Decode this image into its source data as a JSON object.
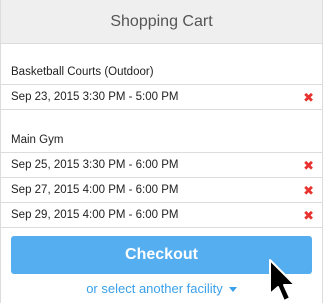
{
  "header": {
    "title": "Shopping Cart"
  },
  "groups": [
    {
      "facility": "Basketball Courts (Outdoor)",
      "items": [
        {
          "time": "Sep 23, 2015 3:30 PM - 5:00 PM",
          "remove_icon": "close-icon"
        }
      ]
    },
    {
      "facility": "Main Gym",
      "items": [
        {
          "time": "Sep 25, 2015 3:30 PM - 6:00 PM",
          "remove_icon": "close-icon"
        },
        {
          "time": "Sep 27, 2015 4:00 PM - 6:00 PM",
          "remove_icon": "close-icon"
        },
        {
          "time": "Sep 29, 2015 4:00 PM - 6:00 PM",
          "remove_icon": "close-icon"
        }
      ]
    }
  ],
  "actions": {
    "checkout_label": "Checkout",
    "another_facility_label": "or select another facility",
    "another_facility_icon": "caret-down-icon"
  },
  "colors": {
    "accent": "#55aef0",
    "link": "#3aa0ea",
    "remove": "#e8322f",
    "header_bg": "#efefef"
  }
}
